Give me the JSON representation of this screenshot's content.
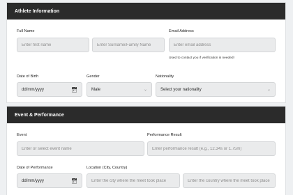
{
  "athlete": {
    "title": "Athlete Information",
    "full_name_label": "Full Name",
    "first_name_placeholder": "Enter first name",
    "surname_placeholder": "Enter Surname/Family Name",
    "email_label": "Email Address",
    "email_placeholder": "Enter email address",
    "email_help": "Used to contact you if verification is needed!",
    "dob_label": "Date of Birth",
    "dob_value": "dd/mm/yyyy",
    "gender_label": "Gender",
    "gender_value": "Male",
    "nationality_label": "Nationality",
    "nationality_value": "Select your nationality"
  },
  "event": {
    "title": "Event & Performance",
    "event_label": "Event",
    "event_placeholder": "Enter or select event name",
    "result_label": "Performance Result",
    "result_placeholder": "Enter performance result (e.g., 12.34s or 1.75m)",
    "date_label": "Date of Performance",
    "date_value": "dd/mm/yyyy",
    "location_label": "Location (City, Country)",
    "city_placeholder": "Enter the city where the meet took place",
    "country_placeholder": "Enter the country where the meet took place"
  },
  "icons": {
    "calendar": "calendar-icon",
    "dropdown": "chevron-down-icon"
  }
}
